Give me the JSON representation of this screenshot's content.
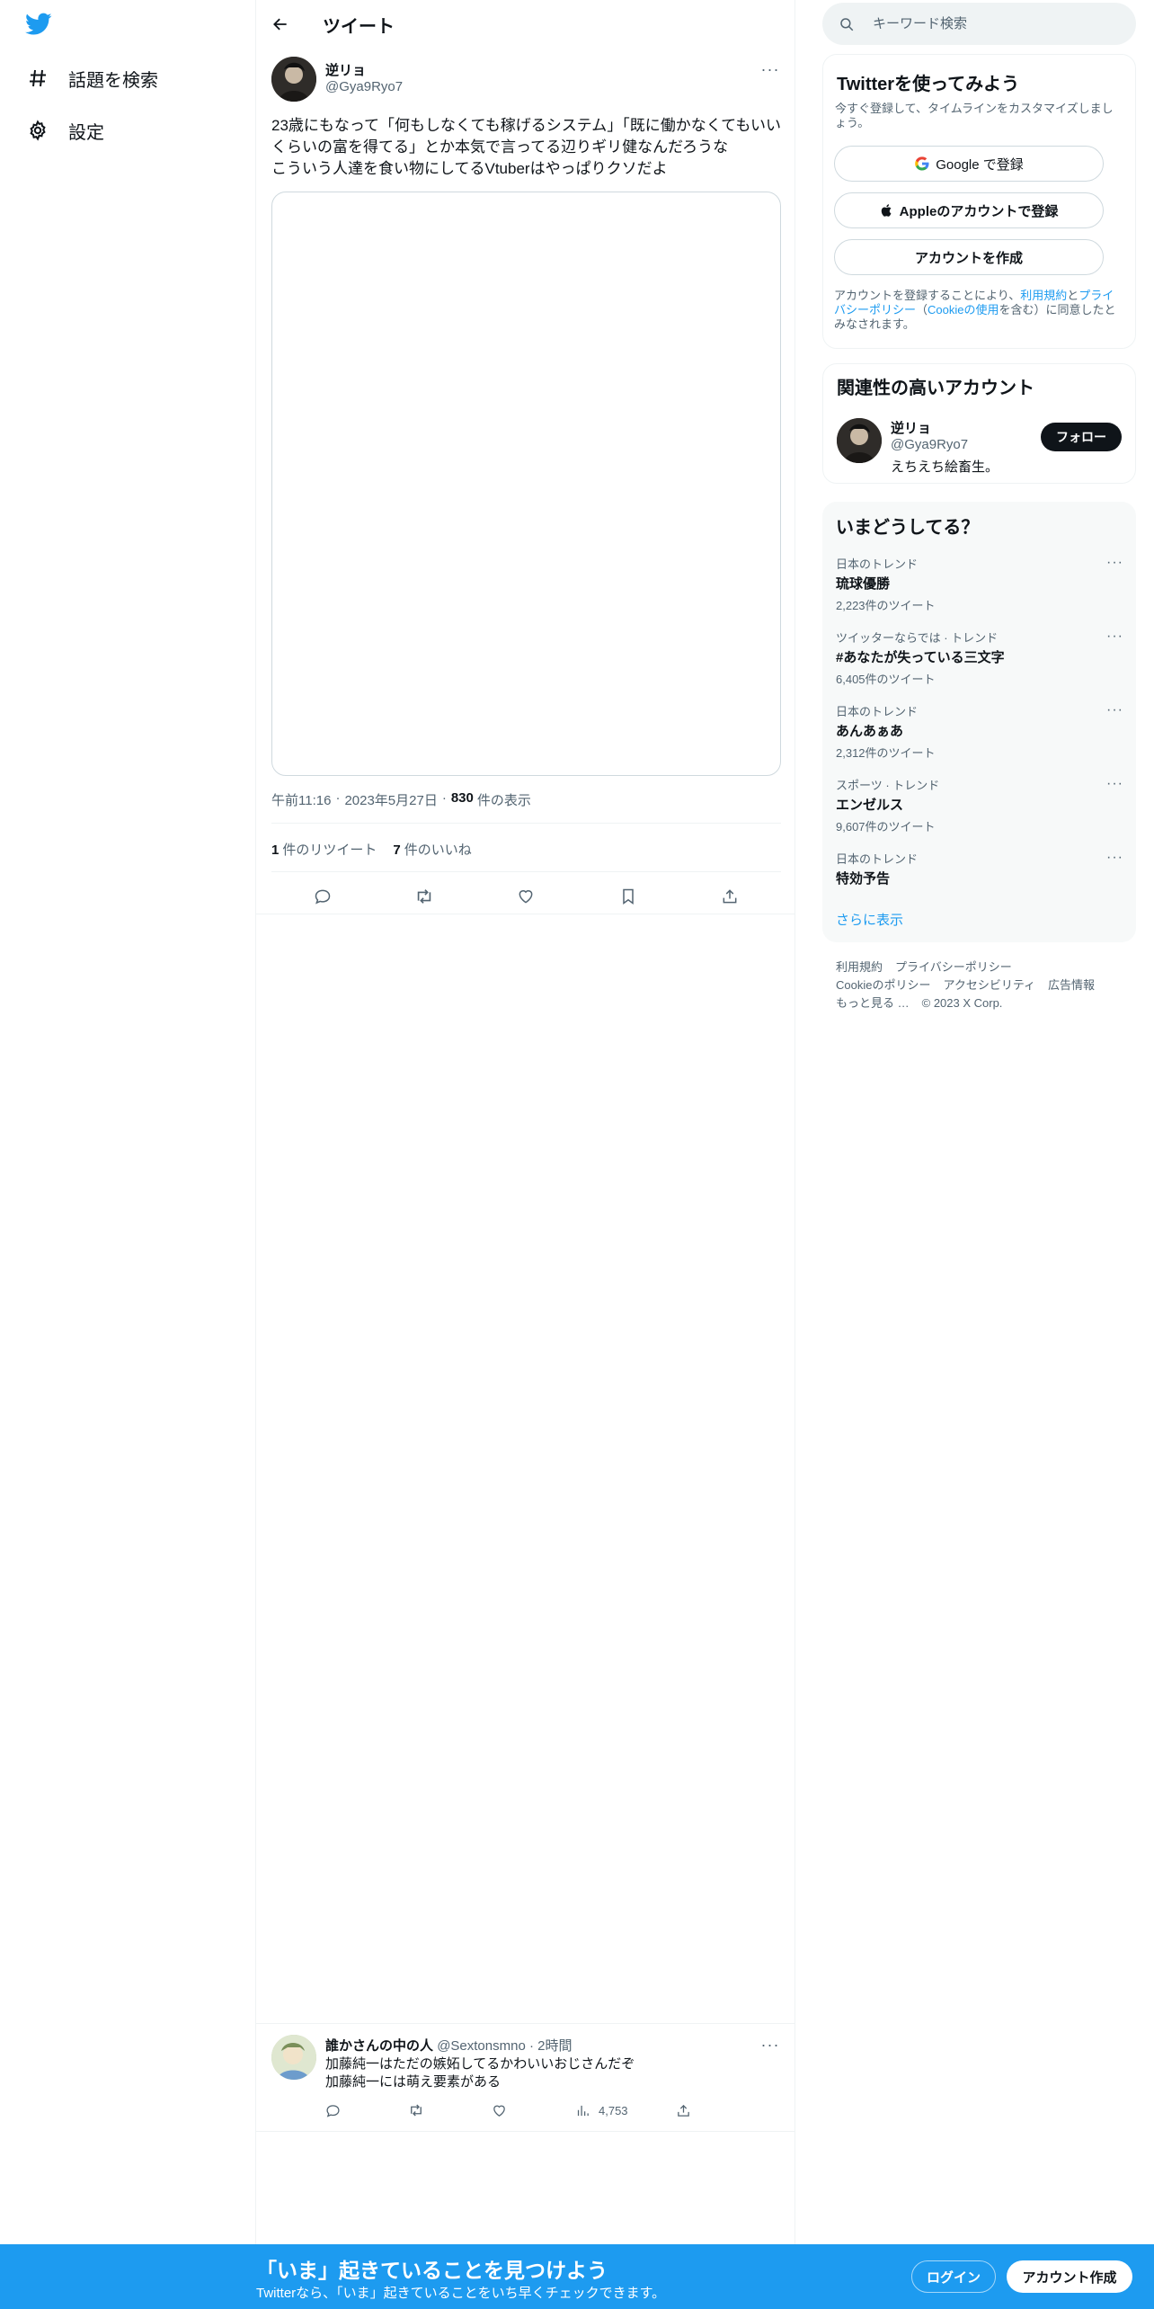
{
  "nav": {
    "items": [
      {
        "label": "話題を検索",
        "icon": "hashtag-icon"
      },
      {
        "label": "設定",
        "icon": "gear-icon"
      }
    ]
  },
  "header": {
    "title": "ツイート"
  },
  "tweet": {
    "author_name": "逆リョ",
    "author_handle": "@Gya9Ryo7",
    "text_lines": [
      "23歳にもなって「何もしなくても稼げるシステム」「既に働かなくてもいい",
      "くらいの富を得てる」とか本気で言ってる辺りギリ健なんだろうな",
      "こういう人達を食い物にしてるVtuberはやっぱりクソだよ"
    ],
    "time": "午前11:16",
    "date": "2023年5月27日",
    "views_count": "830",
    "views_label": "件の表示",
    "retweets_count": "1",
    "retweets_label": "件のリツイート",
    "likes_count": "7",
    "likes_label": "件のいいね"
  },
  "reply": {
    "author_name": "誰かさんの中の人",
    "author_handle": "@Sextonsmno",
    "time": "2時間",
    "text_lines": [
      "加藤純一はただの嫉妬してるかわいいおじさんだぞ",
      "加藤純一には萌え要素がある"
    ],
    "views": "4,753"
  },
  "search": {
    "placeholder": "キーワード検索"
  },
  "signup_card": {
    "title": "Twitterを使ってみよう",
    "subtitle": "今すぐ登録して、タイムラインをカスタマイズしましょう。",
    "google_label": "Google で登録",
    "apple_label": "Appleのアカウントで登録",
    "create_label": "アカウントを作成",
    "legal_prefix": "アカウントを登録することにより、",
    "legal_terms": "利用規約",
    "legal_and": "と",
    "legal_privacy": "プライバシーポリシー",
    "legal_mid": "（",
    "legal_cookie": "Cookieの使用",
    "legal_suffix": "を含む）に同意したとみなされます。"
  },
  "related": {
    "title": "関連性の高いアカウント",
    "name": "逆リョ",
    "handle": "@Gya9Ryo7",
    "bio": "えちえち絵畜生。",
    "follow_label": "フォロー"
  },
  "trends": {
    "title": "いまどうしてる？",
    "items": [
      {
        "context": "日本のトレンド",
        "topic": "琉球優勝",
        "count": "2,223件のツイート"
      },
      {
        "context": "ツイッターならでは · トレンド",
        "topic": "#あなたが失っている三文字",
        "count": "6,405件のツイート"
      },
      {
        "context": "日本のトレンド",
        "topic": "あんあぁあ",
        "count": "2,312件のツイート"
      },
      {
        "context": "スポーツ · トレンド",
        "topic": "エンゼルス",
        "count": "9,607件のツイート"
      },
      {
        "context": "日本のトレンド",
        "topic": "特効予告",
        "count": ""
      }
    ],
    "show_more": "さらに表示"
  },
  "footer": {
    "links": [
      "利用規約",
      "プライバシーポリシー",
      "Cookieのポリシー",
      "アクセシビリティ",
      "広告情報",
      "もっと見る …",
      "© 2023 X Corp."
    ]
  },
  "bottom_bar": {
    "title": "「いま」起きていることを見つけよう",
    "subtitle": "Twitterなら、「いま」起きていることをいち早くチェックできます。",
    "login_label": "ログイン",
    "signup_label": "アカウント作成"
  },
  "colors": {
    "brand": "#1d9bf0",
    "text": "#0f1419",
    "secondary_text": "#536471",
    "border": "#eff3f4"
  }
}
